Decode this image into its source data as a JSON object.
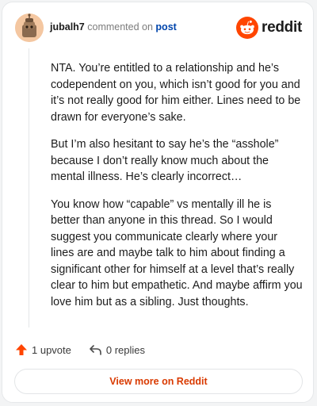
{
  "header": {
    "username": "jubalh7",
    "action_text": "commented on",
    "post_link": "post",
    "brand_name": "reddit",
    "brand_color": "#ff4500"
  },
  "comment": {
    "paragraphs": [
      "NTA. You’re entitled to a relationship and he’s codependent on you, which isn’t good for you and it’s not really good for him either. Lines need to be drawn for everyone’s sake.",
      "But I’m also hesitant to say he’s the “asshole” because I don’t really know much about the mental illness. He’s clearly incorrect…",
      "You know how “capable” vs mentally ill he is better than anyone in this thread. So I would suggest you communicate clearly where your lines are and maybe talk to him about finding a significant other for himself at a level that’s really clear to him but empathetic. And maybe affirm you love him but as a sibling. Just thoughts."
    ]
  },
  "actions": {
    "upvote_icon": "upvote-arrow-icon",
    "upvote_label": "1 upvote",
    "reply_icon": "reply-arrow-icon",
    "replies_label": "0 replies"
  },
  "footer": {
    "view_button_label": "View more on Reddit"
  }
}
